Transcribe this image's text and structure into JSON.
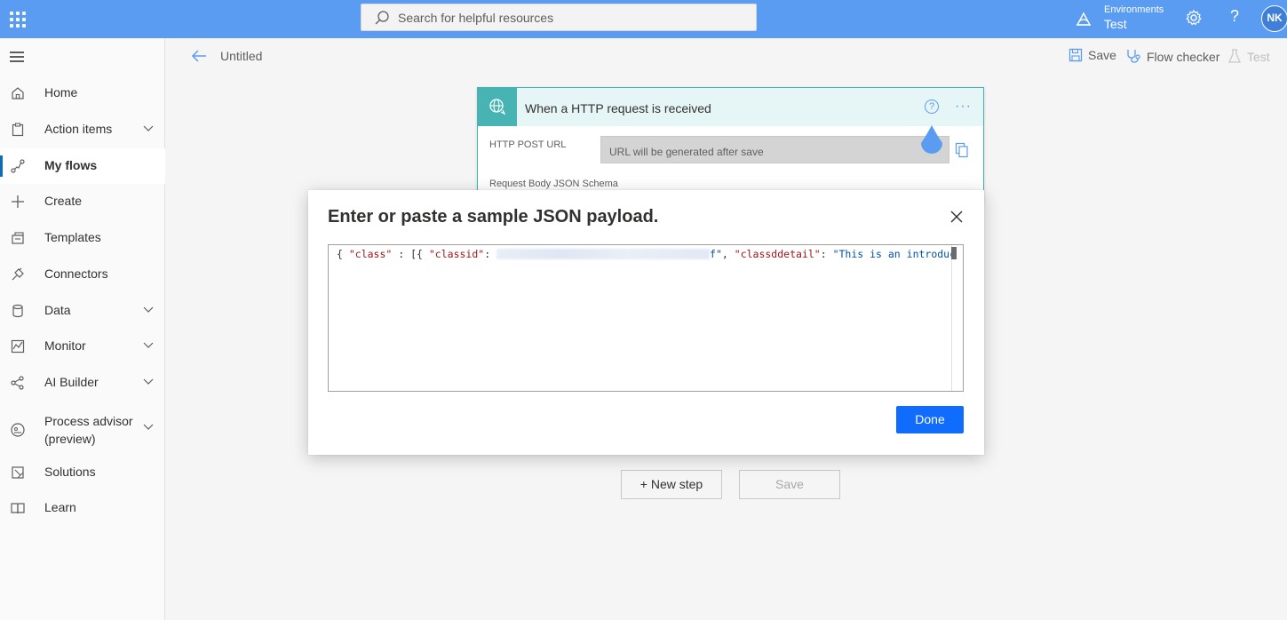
{
  "topbar": {
    "search_placeholder": "Search for helpful resources",
    "env_label": "Environments",
    "env_name": "Test",
    "help_glyph": "?",
    "user_initials": "NK"
  },
  "sidebar": {
    "items": [
      {
        "label": "Home",
        "icon": "home-icon"
      },
      {
        "label": "Action items",
        "icon": "clipboard-icon",
        "expandable": true
      },
      {
        "label": "My flows",
        "icon": "flow-icon",
        "active": true
      },
      {
        "label": "Create",
        "icon": "plus-icon"
      },
      {
        "label": "Templates",
        "icon": "templates-icon"
      },
      {
        "label": "Connectors",
        "icon": "connector-icon"
      },
      {
        "label": "Data",
        "icon": "database-icon",
        "expandable": true
      },
      {
        "label": "Monitor",
        "icon": "monitor-icon",
        "expandable": true
      },
      {
        "label": "AI Builder",
        "icon": "ai-builder-icon",
        "expandable": true
      },
      {
        "label": "Process advisor\n(preview)",
        "icon": "process-advisor-icon",
        "expandable": true
      },
      {
        "label": "Solutions",
        "icon": "solutions-icon"
      },
      {
        "label": "Learn",
        "icon": "book-icon"
      }
    ]
  },
  "commandbar": {
    "title": "Untitled",
    "save": "Save",
    "flow_checker": "Flow checker",
    "test": "Test"
  },
  "trigger_card": {
    "title": "When a HTTP request is received",
    "help_glyph": "?",
    "more_glyph": "···",
    "url_label": "HTTP POST URL",
    "url_value": "URL will be generated after save",
    "schema_label": "Request Body JSON Schema"
  },
  "canvas": {
    "new_step": "+ New step",
    "save": "Save"
  },
  "modal": {
    "title": "Enter or paste a sample JSON payload.",
    "code": {
      "open": "{ ",
      "k1": "\"class\"",
      "p1": " : [{ ",
      "k2": "\"classid\"",
      "p2": ": ",
      "tail": "f\"",
      "p3": ", ",
      "k3": "\"classddetail\"",
      "p4": ": ",
      "v3": "\"This is an introduc"
    },
    "done": "Done"
  },
  "colors": {
    "topbar": "#5a9cf1",
    "accent": "#0f6cfd",
    "card_teal": "#47b4b3"
  }
}
